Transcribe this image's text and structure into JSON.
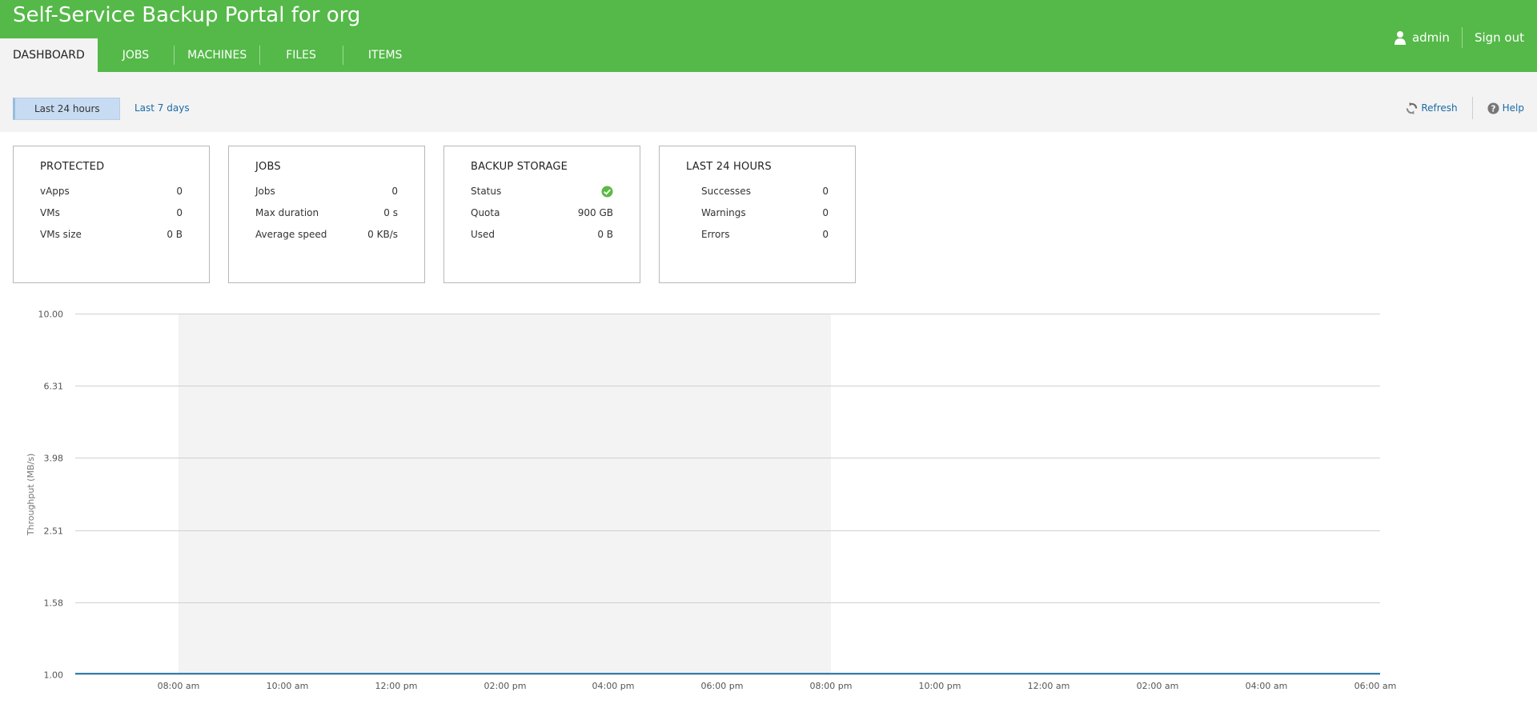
{
  "app": {
    "title": "Self-Service Backup Portal for org"
  },
  "nav": {
    "tabs": [
      {
        "label": "DASHBOARD",
        "active": true
      },
      {
        "label": "JOBS",
        "active": false
      },
      {
        "label": "MACHINES",
        "active": false
      },
      {
        "label": "FILES",
        "active": false
      },
      {
        "label": "ITEMS",
        "active": false
      }
    ]
  },
  "user": {
    "name": "admin",
    "signout_label": "Sign out",
    "icon": "user-icon"
  },
  "toolbar": {
    "periods": [
      {
        "label": "Last 24 hours",
        "active": true
      },
      {
        "label": "Last 7 days",
        "active": false
      }
    ],
    "refresh_label": "Refresh",
    "help_label": "Help",
    "refresh_icon": "refresh-icon",
    "help_icon": "help-icon"
  },
  "cards": {
    "protected": {
      "title": "PROTECTED",
      "rows": [
        {
          "label": "vApps",
          "value": "0"
        },
        {
          "label": "VMs",
          "value": "0"
        },
        {
          "label": "VMs size",
          "value": "0 B"
        }
      ]
    },
    "jobs": {
      "title": "JOBS",
      "rows": [
        {
          "label": "Jobs",
          "value": "0"
        },
        {
          "label": "Max duration",
          "value": "0 s"
        },
        {
          "label": "Average speed",
          "value": "0 KB/s"
        }
      ]
    },
    "storage": {
      "title": "BACKUP STORAGE",
      "rows": [
        {
          "label": "Status",
          "value": "",
          "icon": "status-ok-icon"
        },
        {
          "label": "Quota",
          "value": "900 GB"
        },
        {
          "label": "Used",
          "value": "0 B"
        }
      ]
    },
    "last24": {
      "title": "LAST 24 HOURS",
      "rows": [
        {
          "label": "Successes",
          "value": "0"
        },
        {
          "label": "Warnings",
          "value": "0"
        },
        {
          "label": "Errors",
          "value": "0"
        }
      ]
    }
  },
  "colors": {
    "header_green": "#54b948",
    "status_ok": "#5cb946",
    "series_line": "#2f7fb0",
    "shaded_band": "#f3f3f3"
  },
  "chart_data": {
    "type": "line",
    "ylabel": "Throughput (MB/s)",
    "y_ticks": [
      "1.00",
      "1.58",
      "2.51",
      "3.98",
      "6.31",
      "10.00"
    ],
    "y_tick_values": [
      1.0,
      1.58,
      2.51,
      3.98,
      6.31,
      10.0
    ],
    "y_scale": "log",
    "ylim": [
      1.0,
      10.0
    ],
    "x_ticks": [
      "08:00 am",
      "10:00 am",
      "12:00 pm",
      "02:00 pm",
      "04:00 pm",
      "06:00 pm",
      "08:00 pm",
      "10:00 pm",
      "12:00 am",
      "02:00 am",
      "04:00 am",
      "06:00 am"
    ],
    "x_start": "06:06 am",
    "x_end": "06:00 am",
    "shaded_band": {
      "from": "08:00 am",
      "to": "08:00 pm"
    },
    "grid": true,
    "series": [
      {
        "values": [
          1.0,
          1.0
        ]
      }
    ]
  }
}
